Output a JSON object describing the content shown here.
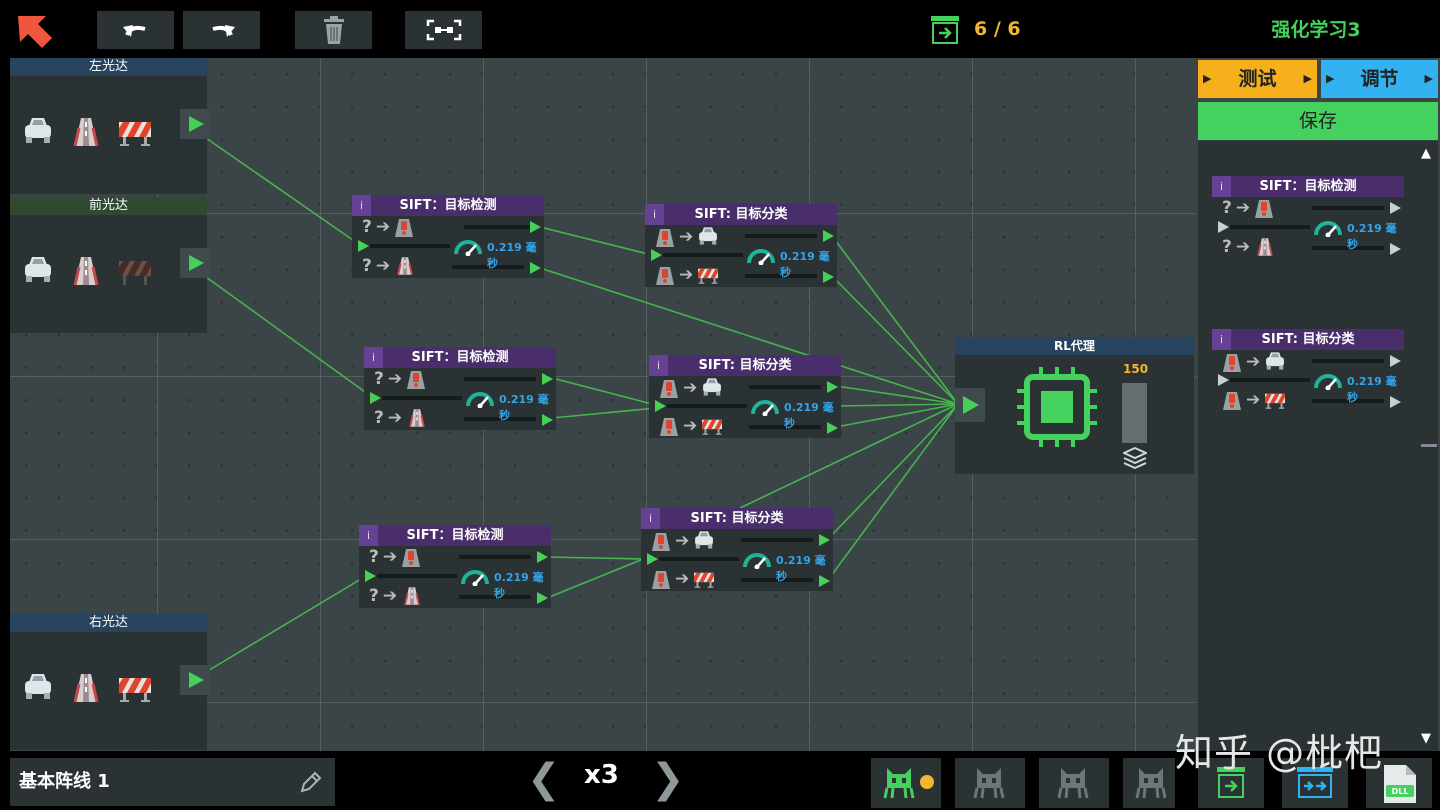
{
  "header": {
    "score": "6 / 6",
    "level_title": "强化学习3"
  },
  "sensors": [
    {
      "name": "左光达"
    },
    {
      "name": "前光达"
    },
    {
      "name": "右光达"
    }
  ],
  "nodes": [
    {
      "title": "SIFT：目标检测",
      "info": "i",
      "latency": "0.219 毫秒"
    },
    {
      "title": "SIFT: 目标分类",
      "info": "i",
      "latency": "0.219 毫秒"
    },
    {
      "title": "SIFT：目标检测",
      "info": "i",
      "latency": "0.219 毫秒"
    },
    {
      "title": "SIFT: 目标分类",
      "info": "i",
      "latency": "0.219 毫秒"
    },
    {
      "title": "SIFT：目标检测",
      "info": "i",
      "latency": "0.219 毫秒"
    },
    {
      "title": "SIFT: 目标分类",
      "info": "i",
      "latency": "0.219 毫秒"
    }
  ],
  "rl_agent": {
    "title": "RL代理",
    "value": "150"
  },
  "panel": {
    "test_tab": "测试",
    "tune_tab": "调节",
    "save_button": "保存",
    "library": [
      {
        "title": "SIFT：目标检测",
        "latency": "0.219 毫秒"
      },
      {
        "title": "SIFT: 目标分类",
        "latency": "0.219 毫秒"
      }
    ]
  },
  "footer": {
    "layout_name": "基本阵线 1",
    "speed": "x3",
    "dll_label": "DLL"
  },
  "watermark": "知乎 @枇杷",
  "colors": {
    "accent_green": "#45d15d",
    "accent_orange": "#f2b630",
    "accent_blue": "#32b2f0",
    "node_header": "#4a2e6c",
    "latency_blue": "#32a4e8"
  }
}
